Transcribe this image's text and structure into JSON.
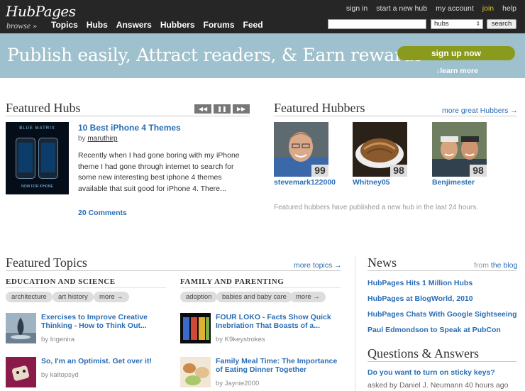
{
  "header": {
    "logo": "HubPages",
    "browse": "browse »",
    "nav": [
      "Topics",
      "Hubs",
      "Answers",
      "Hubbers",
      "Forums",
      "Feed"
    ],
    "toplinks": [
      "sign in",
      "start a new hub",
      "my account",
      "join",
      "help"
    ],
    "search_select": "hubs",
    "search_button": "search"
  },
  "banner": {
    "text": "Publish easily, Attract readers, & Earn rewards",
    "signup": "sign up now",
    "learnmore": "↓learn more"
  },
  "featured_hubs": {
    "heading": "Featured Hubs",
    "controls": [
      "◀◀",
      "❚❚",
      "▶▶"
    ],
    "thumb_title": "BLUE MATRIX",
    "thumb_caption": "NOW FOR IPHONE",
    "title": "10 Best iPhone 4 Themes",
    "by_prefix": "by",
    "author": "maruthirp",
    "description": "Recently when I had gone boring with my iPhone theme I had gone through internet to search for some new interesting best iphone 4 themes available that suit good for iPhone 4. There...",
    "comments": "20 Comments"
  },
  "featured_hubbers": {
    "heading": "Featured Hubbers",
    "more": "more great Hubbers →",
    "hubbers": [
      {
        "name": "stevemark122000",
        "score": "99"
      },
      {
        "name": "Whitney05",
        "score": "98"
      },
      {
        "name": "Benjimester",
        "score": "98"
      }
    ],
    "note": "Featured hubbers have published a new hub in the last 24 hours."
  },
  "featured_topics": {
    "heading": "Featured Topics",
    "more": "more topics →",
    "categories": [
      {
        "title": "EDUCATION AND SCIENCE",
        "tags": [
          "architecture",
          "art history",
          "more →"
        ],
        "items": [
          {
            "title": "Exercises to Improve Creative Thinking - How to Think Out...",
            "by": "by Ingenira"
          },
          {
            "title": "So, I'm an Optimist. Get over it!",
            "by": "by kaltopsyd"
          }
        ]
      },
      {
        "title": "FAMILY AND PARENTING",
        "tags": [
          "adoption",
          "babies and baby care",
          "more →"
        ],
        "items": [
          {
            "title": "FOUR LOKO - Facts Show Quick Inebriation That Boasts of a...",
            "by": "by K9keystrokes"
          },
          {
            "title": "Family Meal Time: The Importance of Eating Dinner Together",
            "by": "by Jaynie2000"
          }
        ]
      }
    ]
  },
  "news": {
    "heading": "News",
    "from_prefix": "from",
    "from_link": "the blog",
    "items": [
      "HubPages Hits 1 Million Hubs",
      "HubPages at BlogWorld, 2010",
      "HubPages Chats With Google Sightseeing",
      "Paul Edmondson to Speak at PubCon"
    ]
  },
  "qa": {
    "heading": "Questions & Answers",
    "question": "Do you want to turn on sticky keys?",
    "asked": "asked by Daniel J. Neumann 40 hours ago"
  }
}
